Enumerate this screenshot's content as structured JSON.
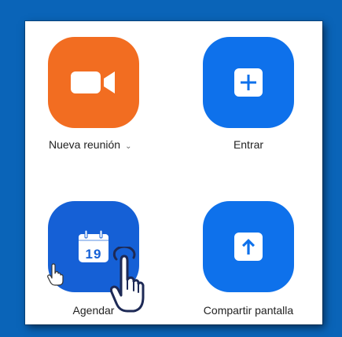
{
  "actions": {
    "new_meeting": {
      "label": "Nueva reunión",
      "chevron": "⌄",
      "icon": "video-camera-icon",
      "color": "#f26d21"
    },
    "join": {
      "label": "Entrar",
      "icon": "plus-icon",
      "color": "#0e71eb"
    },
    "schedule": {
      "label": "Agendar",
      "icon": "calendar-icon",
      "day": "19",
      "color": "#1560d6"
    },
    "share_screen": {
      "label": "Compartir pantalla",
      "icon": "up-arrow-icon",
      "color": "#0e71eb"
    }
  },
  "background_color": "#0a64b8"
}
